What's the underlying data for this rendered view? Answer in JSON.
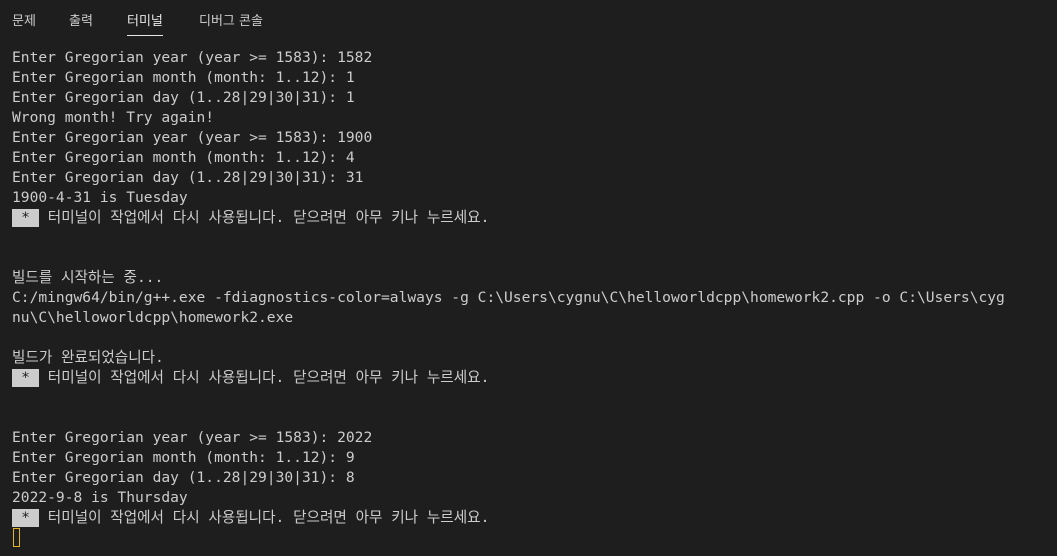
{
  "tabs": [
    {
      "label": "문제"
    },
    {
      "label": "출력"
    },
    {
      "label": "터미널"
    },
    {
      "label": "디버그 콘솔"
    }
  ],
  "active_tab": "터미널",
  "terminal": {
    "lines": [
      "Enter Gregorian year (year >= 1583): 1582",
      "Enter Gregorian month (month: 1..12): 1",
      "Enter Gregorian day (1..28|29|30|31): 1",
      "Wrong month! Try again!",
      "Enter Gregorian year (year >= 1583): 1900",
      "Enter Gregorian month (month: 1..12): 4",
      "Enter Gregorian day (1..28|29|30|31): 31",
      "1900-4-31 is Tuesday",
      "빌드를 시작하는 중...",
      "C:/mingw64/bin/g++.exe -fdiagnostics-color=always -g C:\\Users\\cygnu\\C\\helloworldcpp\\homework2.cpp -o C:\\Users\\cyg",
      "nu\\C\\helloworldcpp\\homework2.exe",
      "빌드가 완료되었습니다.",
      "Enter Gregorian year (year >= 1583): 2022",
      "Enter Gregorian month (month: 1..12): 9",
      "Enter Gregorian day (1..28|29|30|31): 8",
      "2022-9-8 is Thursday"
    ],
    "badge_text": "*",
    "reuse_message": " 터미널이 작업에서 다시 사용됩니다. 닫으려면 아무 키나 누르세요."
  },
  "colors": {
    "background": "#1e1e1e",
    "text": "#cccccc",
    "cursor": "#e6b422"
  }
}
